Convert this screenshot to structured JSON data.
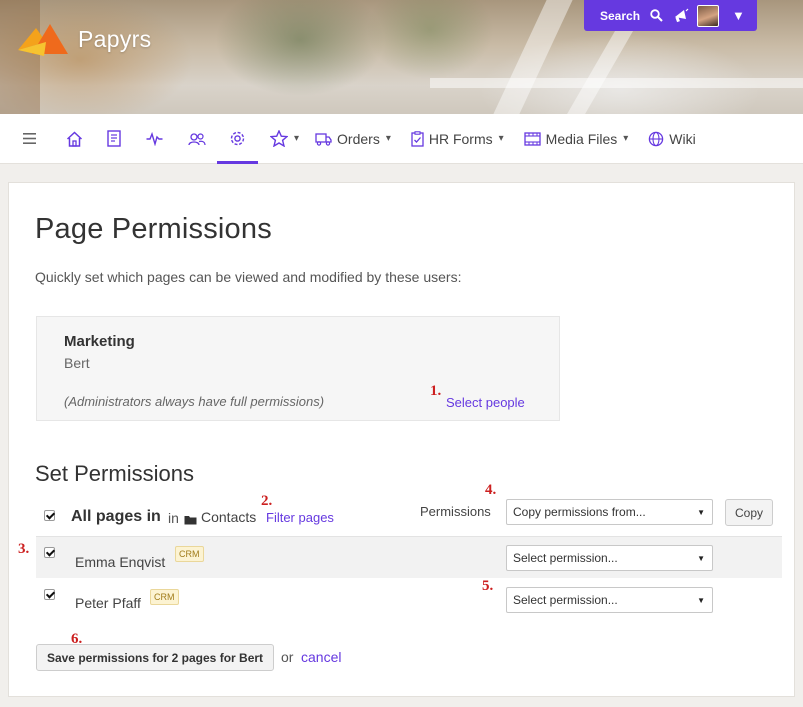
{
  "app": {
    "name": "Papyrs"
  },
  "topbar": {
    "search_label": "Search"
  },
  "nav": {
    "items": [
      {
        "icon": "hamburger-icon"
      },
      {
        "icon": "home-icon"
      },
      {
        "icon": "document-icon"
      },
      {
        "icon": "activity-icon"
      },
      {
        "icon": "users-icon"
      },
      {
        "icon": "gear-icon",
        "active": true
      },
      {
        "icon": "star-icon"
      },
      {
        "icon": "truck-icon",
        "label": "Orders"
      },
      {
        "icon": "clipboard-icon",
        "label": "HR Forms"
      },
      {
        "icon": "film-icon",
        "label": "Media Files"
      },
      {
        "icon": "globe-icon",
        "label": "Wiki"
      }
    ]
  },
  "page": {
    "title": "Page Permissions",
    "intro": "Quickly set which pages can be viewed and modified by these users:"
  },
  "group": {
    "name": "Marketing",
    "member": "Bert",
    "note": "(Administrators always have full permissions)",
    "select_people": "Select people"
  },
  "set_permissions": {
    "title": "Set Permissions",
    "all_pages_label": "All pages in",
    "in_word": "in",
    "folder_name": "Contacts",
    "filter_pages": "Filter pages",
    "permissions_label": "Permissions",
    "copy_select": "Copy permissions from...",
    "copy_button": "Copy",
    "rows": [
      {
        "name": "Emma Enqvist",
        "badge": "CRM",
        "permission": "Select permission..."
      },
      {
        "name": "Peter Pfaff",
        "badge": "CRM",
        "permission": "Select permission..."
      }
    ]
  },
  "actions": {
    "save_button": "Save permissions for 2 pages for Bert",
    "or_word": "or",
    "cancel": "cancel"
  },
  "annotations": {
    "n1": "1.",
    "n2": "2.",
    "n3": "3.",
    "n4": "4.",
    "n5": "5.",
    "n6": "6."
  },
  "colors": {
    "accent": "#6639e0",
    "annotation": "#cc1f1f",
    "badge_bg": "#fcf3d2"
  }
}
